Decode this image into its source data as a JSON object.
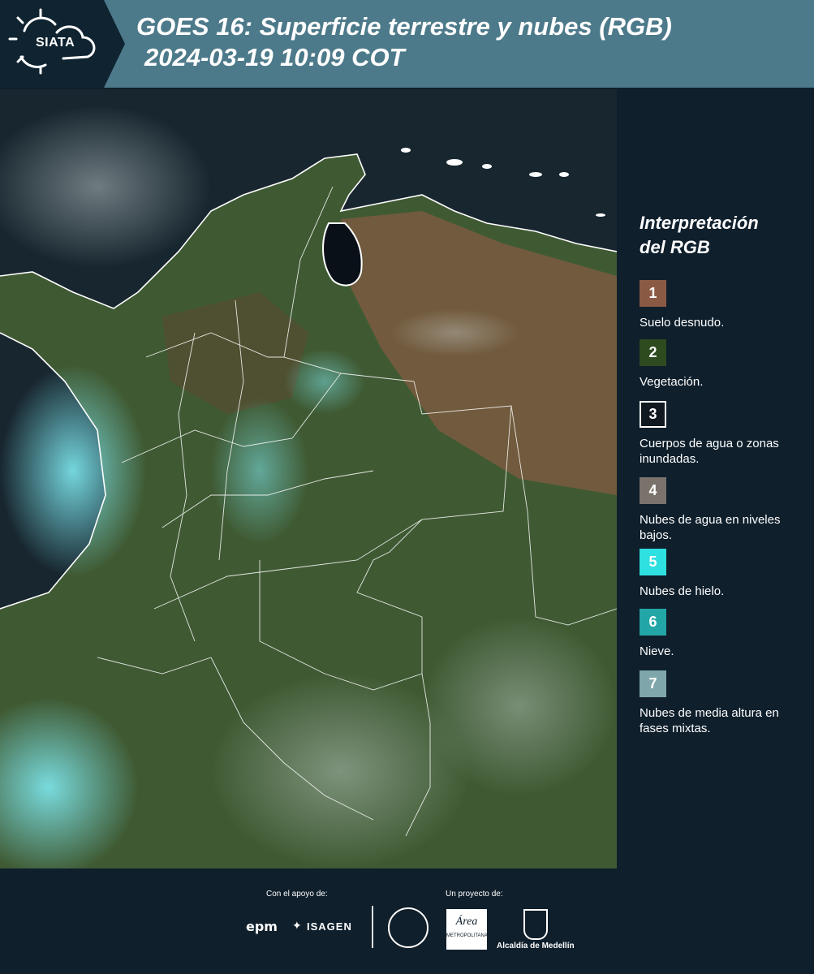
{
  "header": {
    "logo_text": "SIATA",
    "title_line1": "GOES 16: Superficie terrestre y nubes (RGB)",
    "title_line2": "2024-03-19 10:09 COT"
  },
  "legend": {
    "title_line1": "Interpretación",
    "title_line2": "del RGB",
    "items": [
      {
        "number": "1",
        "label": "Suelo desnudo.",
        "color": "#8b5a45"
      },
      {
        "number": "2",
        "label": "Vegetación.",
        "color": "#2e4a1f"
      },
      {
        "number": "3",
        "label": "Cuerpos de agua o zonas inundadas.",
        "color": "#101820"
      },
      {
        "number": "4",
        "label": "Nubes de agua en niveles bajos.",
        "color": "#7a736c"
      },
      {
        "number": "5",
        "label": "Nubes de hielo.",
        "color": "#2fe0e0"
      },
      {
        "number": "6",
        "label": "Nieve.",
        "color": "#23a6a6"
      },
      {
        "number": "7",
        "label": "Nubes de media altura en fases mixtas.",
        "color": "#7fa6aa"
      }
    ]
  },
  "footer": {
    "support_label": "Con el apoyo de:",
    "project_label": "Un proyecto de:",
    "sponsor_epm": "epm",
    "sponsor_isagen": "ISAGEN",
    "partner_area_label": "Área",
    "partner_area_sub": "METROPOLITANA",
    "partner_alcaldia": "Alcaldía de Medellín"
  }
}
